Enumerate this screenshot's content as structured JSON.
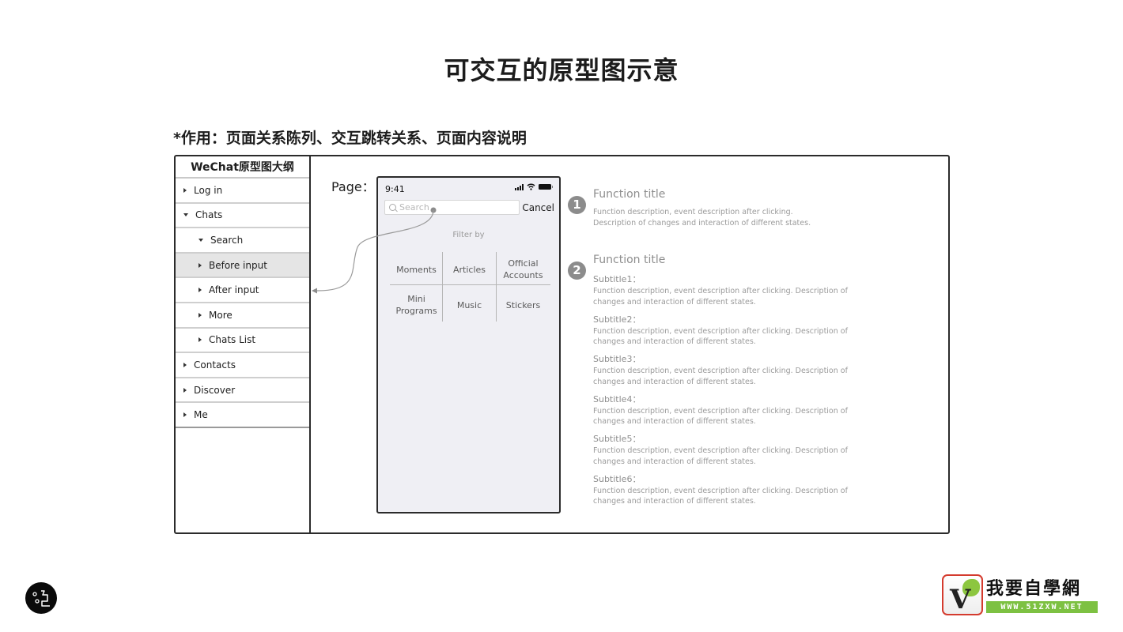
{
  "header": {
    "title": "可交互的原型图示意",
    "subtitle": "*作用：页面关系陈列、交互跳转关系、页面内容说明"
  },
  "outline": {
    "title": "WeChat原型图大纲",
    "items": [
      {
        "label": "Log in",
        "level": 0,
        "expanded": false,
        "selected": false
      },
      {
        "label": "Chats",
        "level": 0,
        "expanded": true,
        "selected": false
      },
      {
        "label": "Search",
        "level": 1,
        "expanded": true,
        "selected": false
      },
      {
        "label": "Before input",
        "level": 1,
        "expanded": false,
        "selected": true
      },
      {
        "label": "After input",
        "level": 1,
        "expanded": false,
        "selected": false
      },
      {
        "label": "More",
        "level": 1,
        "expanded": false,
        "selected": false
      },
      {
        "label": "Chats List",
        "level": 1,
        "expanded": false,
        "selected": false
      },
      {
        "label": "Contacts",
        "level": 0,
        "expanded": false,
        "selected": false
      },
      {
        "label": "Discover",
        "level": 0,
        "expanded": false,
        "selected": false
      },
      {
        "label": "Me",
        "level": 0,
        "expanded": false,
        "selected": false
      }
    ]
  },
  "page": {
    "label": "Page：",
    "phone": {
      "time": "9:41",
      "status_icons": [
        "signal-icon",
        "wifi-icon",
        "battery-icon"
      ],
      "search_placeholder": "Search",
      "cancel_label": "Cancel",
      "filter_label": "Filter by",
      "filters": [
        "Moments",
        "Articles",
        "Official Accounts",
        "Mini Programs",
        "Music",
        "Stickers"
      ]
    }
  },
  "annotations": [
    {
      "number": "1",
      "title": "Function title",
      "description_lines": [
        "Function description, event description after clicking.",
        "Description of changes and interaction of different states."
      ]
    },
    {
      "number": "2",
      "title": "Function title",
      "subsections": [
        {
          "subtitle": "Subtitle1：",
          "lines": [
            "Function description, event description after clicking. Description of",
            "changes and interaction of different states."
          ]
        },
        {
          "subtitle": "Subtitle2：",
          "lines": [
            "Function description, event description after clicking. Description of",
            "changes and interaction of different states."
          ]
        },
        {
          "subtitle": "Subtitle3：",
          "lines": [
            "Function description, event description after clicking. Description of",
            "changes and interaction of different states."
          ]
        },
        {
          "subtitle": "Subtitle4：",
          "lines": [
            "Function description, event description after clicking. Description of",
            "changes and interaction of different states."
          ]
        },
        {
          "subtitle": "Subtitle5：",
          "lines": [
            "Function description, event description after clicking. Description of",
            "changes and interaction of different states."
          ]
        },
        {
          "subtitle": "Subtitle6：",
          "lines": [
            "Function description, event description after clicking. Description of",
            "changes and interaction of different states."
          ]
        }
      ]
    }
  ],
  "branding": {
    "right_logo_title": "我要自學網",
    "right_logo_url": "WWW.51ZXW.NET",
    "right_logo_letter": "V"
  },
  "colors": {
    "frame": "#2b2b2b",
    "phone_bg": "#efeff4",
    "selected_row": "#e5e5e5",
    "badge": "#8c8c8c",
    "annotation_text": "#8e8e8e",
    "logo_green": "#7dc142",
    "logo_red": "#d43b2e"
  }
}
